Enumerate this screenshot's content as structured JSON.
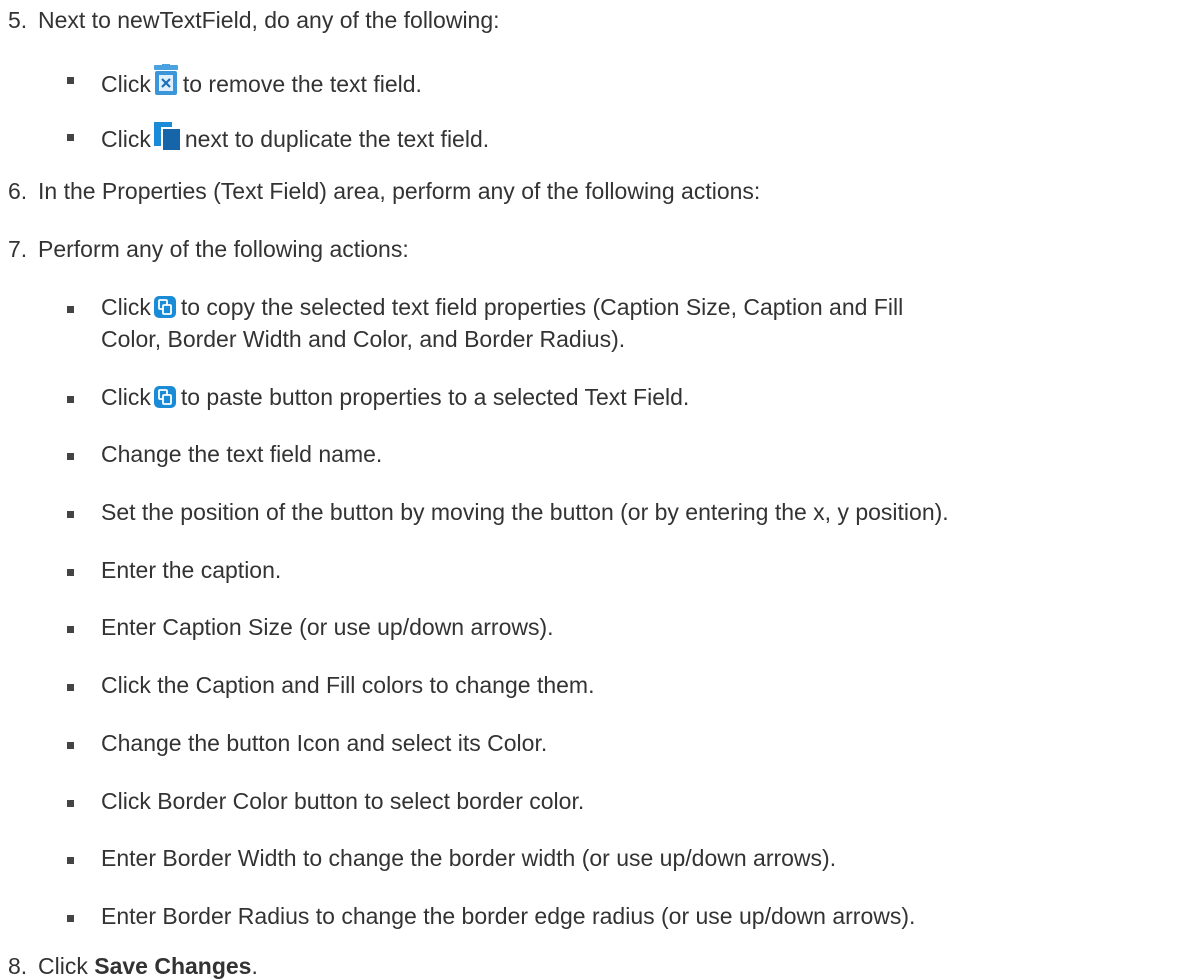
{
  "steps": {
    "s5": {
      "num": "5.",
      "text": "Next to newTextField, do any of the following:",
      "b1": {
        "pre": "Click",
        "icon": "trash-icon",
        "post": "to remove the text field."
      },
      "b2": {
        "pre": "Click",
        "icon": "duplicate-icon",
        "post": "next to duplicate the text field."
      }
    },
    "s6": {
      "num": "6.",
      "text": "In the Properties (Text Field) area, perform any of the following actions:"
    },
    "s7": {
      "num": "7.",
      "text": "Perform any of the following actions:",
      "b1": {
        "pre": "Click",
        "icon": "copy-properties-icon",
        "post": "to copy the selected text field properties (Caption Size, Caption and Fill",
        "cont": "Color, Border Width and Color, and Border Radius)."
      },
      "b2": {
        "pre": "Click",
        "icon": "paste-properties-icon",
        "post": "to paste button properties to a selected Text Field."
      },
      "b3": "Change the text field name.",
      "b4": "Set the position of the button by moving the button (or by entering the x, y position).",
      "b5": "Enter the caption.",
      "b6": "Enter Caption Size (or use up/down arrows).",
      "b7": "Click the Caption and Fill colors to change them.",
      "b8": "Change the button Icon and select its Color.",
      "b9": "Click Border Color button to select border color.",
      "b10": "Enter Border Width to change the border width (or use up/down arrows).",
      "b11": "Enter Border Radius to change the border edge radius (or use up/down arrows)."
    },
    "s8": {
      "num": "8.",
      "pre": "Click",
      "bold": "Save Changes",
      "post": "."
    }
  },
  "colors": {
    "text": "#333333",
    "icon_blue": "#1a8bd6",
    "icon_dark_blue": "#1565a8"
  }
}
